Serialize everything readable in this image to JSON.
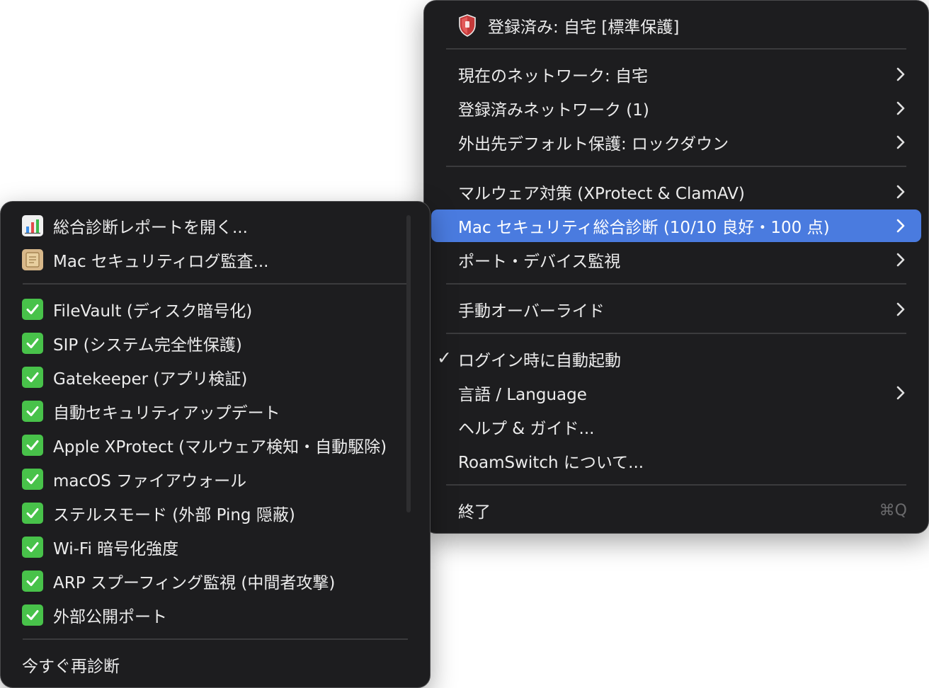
{
  "main_menu": {
    "header": {
      "label": "登録済み: 自宅 [標準保護]",
      "icon": "shield-icon"
    },
    "items": [
      {
        "label": "現在のネットワーク: 自宅",
        "submenu": true
      },
      {
        "label": "登録済みネットワーク (1)",
        "submenu": true
      },
      {
        "label": "外出先デフォルト保護: ロックダウン",
        "submenu": true
      },
      {
        "label": "マルウェア対策 (XProtect & ClamAV)",
        "submenu": true
      },
      {
        "label": "Mac セキュリティ総合診断 (10/10 良好・100 点)",
        "submenu": true,
        "highlighted": true
      },
      {
        "label": "ポート・デバイス監視",
        "submenu": true
      },
      {
        "label": "手動オーバーライド",
        "submenu": true
      },
      {
        "label": "ログイン時に自動起動",
        "checked": true,
        "check_mark": "✓"
      },
      {
        "label": "言語 / Language",
        "submenu": true
      },
      {
        "label": "ヘルプ & ガイド..."
      },
      {
        "label": "RoamSwitch について..."
      },
      {
        "label": "終了",
        "shortcut": "⌘Q"
      }
    ]
  },
  "sub_menu": {
    "actions": [
      {
        "label": "総合診断レポートを開く...",
        "icon": "bar-chart-icon"
      },
      {
        "label": "Mac セキュリティログ監査...",
        "icon": "scroll-icon"
      }
    ],
    "checks": [
      {
        "label": "FileVault (ディスク暗号化)",
        "status": "ok"
      },
      {
        "label": "SIP (システム完全性保護)",
        "status": "ok"
      },
      {
        "label": "Gatekeeper (アプリ検証)",
        "status": "ok"
      },
      {
        "label": "自動セキュリティアップデート",
        "status": "ok"
      },
      {
        "label": "Apple XProtect (マルウェア検知・自動駆除)",
        "status": "ok"
      },
      {
        "label": "macOS ファイアウォール",
        "status": "ok"
      },
      {
        "label": "ステルスモード (外部 Ping 隠蔽)",
        "status": "ok"
      },
      {
        "label": "Wi-Fi 暗号化強度",
        "status": "ok"
      },
      {
        "label": "ARP スプーフィング監視 (中間者攻撃)",
        "status": "ok"
      },
      {
        "label": "外部公開ポート",
        "status": "ok"
      }
    ],
    "rescan_label": "今すぐ再診断"
  },
  "colors": {
    "menu_bg": "#1d1d1f",
    "highlight": "#4a7bdf",
    "check_green": "#48c24a",
    "separator": "#3b3b3d"
  }
}
